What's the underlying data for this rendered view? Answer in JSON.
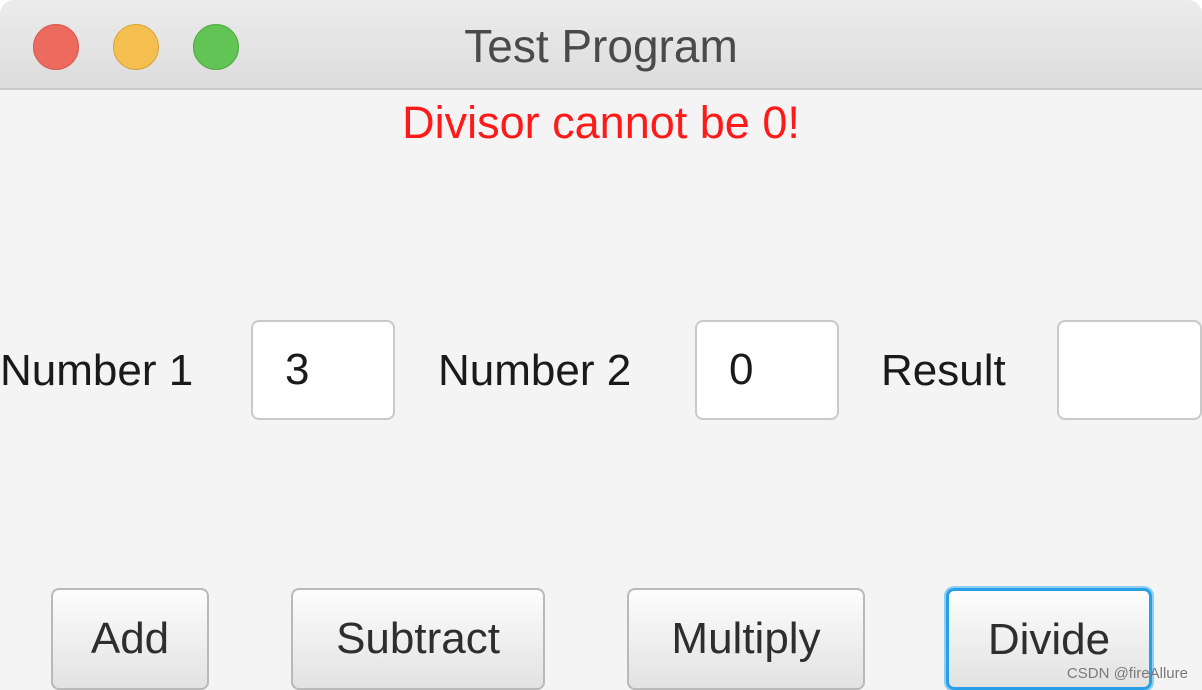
{
  "window": {
    "title": "Test Program",
    "controls": [
      "close-icon",
      "minimize-icon",
      "zoom-icon"
    ],
    "colors": {
      "close": "#ed6a5e",
      "minimize": "#f5bf4f",
      "zoom": "#62c454"
    }
  },
  "message": {
    "text": "Divisor cannot be 0!",
    "color": "#ff1a1a"
  },
  "form": {
    "number1": {
      "label": "Number 1",
      "value": "3"
    },
    "number2": {
      "label": "Number 2",
      "value": "0"
    },
    "result": {
      "label": "Result",
      "value": ""
    }
  },
  "buttons": {
    "add": "Add",
    "subtract": "Subtract",
    "multiply": "Multiply",
    "divide": "Divide",
    "focused": "divide",
    "focus_color": "#27a0e8"
  },
  "watermark": "CSDN @fireAllure"
}
